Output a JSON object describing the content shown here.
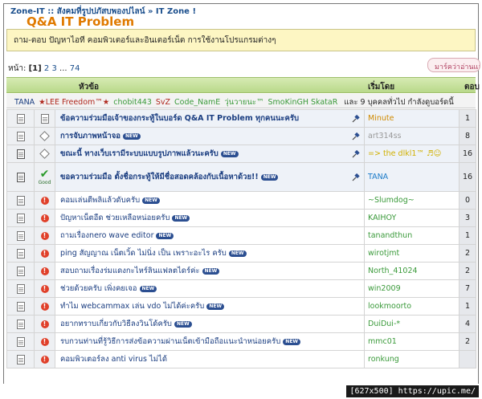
{
  "breadcrumb": {
    "root": "Zone-IT",
    "sep1": "::",
    "community": "สังคมที่รูปปภัสบพองปไลน์",
    "sep2": "»",
    "section": "IT Zone !"
  },
  "forum": {
    "title": "Q&A IT Problem",
    "description": "ถาม-ตอบ ปัญหาไอที คอมพิวเตอร์และอินเตอร์เน็ต การใช้งานโปรแกรมต่างๆ"
  },
  "pager": {
    "label": "หน้า:",
    "current": "[1]",
    "pages": [
      "2",
      "3"
    ],
    "ellipsis": "...",
    "last": "74"
  },
  "mark_read_label": "มาร์คว่าอ่านแล้ว",
  "table_header": {
    "subject": "หัวข้อ",
    "started_by": "เริ่มโดย",
    "replies": "ตอบ"
  },
  "viewers": {
    "users": [
      {
        "name": "TANA",
        "color": "#1a3d80"
      },
      {
        "name": "★LEE Freedom™★",
        "color": "#b0281e"
      },
      {
        "name": "chobit443",
        "color": "#3a9a3a"
      },
      {
        "name": "SvZ",
        "color": "#b0281e"
      },
      {
        "name": "Code_NamE",
        "color": "#3a9a3a"
      },
      {
        "name": "วุ่นวายนะ™",
        "color": "#3a9a3a"
      },
      {
        "name": "SmoKinGH SkataR",
        "color": "#3a9a3a"
      }
    ],
    "suffix": "และ 9 บุคคลทั่วไป กำลังดูบอร์ดนี้"
  },
  "new_badge": "NEW",
  "good_label": "Good",
  "topics": [
    {
      "title": "ข้อความร่วมมือเจ้าของกระทู้ในบอร์ด Q&A IT Problem ทุกคนนะครับ",
      "starter": "Minute",
      "starter_color": "#d08a00",
      "replies": "1",
      "sticky": true,
      "pinned": true,
      "new": false,
      "icon": "doc",
      "status": "note"
    },
    {
      "title": "การจับภาพหน้าจอ",
      "starter": "art314ss",
      "starter_color": "#999999",
      "replies": "8",
      "sticky": true,
      "pinned": true,
      "new": true,
      "icon": "doc",
      "status": "diamond"
    },
    {
      "title": "ขณะนี้ ทางเว็บเรามีระบบแบบรูปภาพแล้วนะครับ",
      "starter": "=> the dlkl1™ ♬☺",
      "starter_color": "#d0b000",
      "replies": "16",
      "sticky": true,
      "pinned": true,
      "new": true,
      "icon": "hot",
      "status": "diamond"
    },
    {
      "title": "ขอความร่วมมือ ตั้งชื่อกระทู้ให้มีชื่อสอดคล้องกับเนื้อหาด้วย!!",
      "starter": "TANA",
      "starter_color": "#1a7ac8",
      "replies": "16",
      "sticky": true,
      "pinned": true,
      "new": true,
      "icon": "hot",
      "status": "good",
      "tall": true
    },
    {
      "title": "คอมเล่นตีพลิแล้วดับครับ",
      "starter": "~Slumdog~",
      "starter_color": "#3a9a3a",
      "replies": "0",
      "sticky": false,
      "pinned": false,
      "new": true,
      "icon": "doc",
      "status": "bang"
    },
    {
      "title": "ปัญหาเน็ตอืด ช่วยเหลือหน่อยครับ",
      "starter": "KAIHOY",
      "starter_color": "#3a9a3a",
      "replies": "3",
      "sticky": false,
      "pinned": false,
      "new": true,
      "icon": "doc",
      "status": "bang"
    },
    {
      "title": "ถามเรื่องnero wave editor",
      "starter": "tanandthun",
      "starter_color": "#3a9a3a",
      "replies": "1",
      "sticky": false,
      "pinned": false,
      "new": true,
      "icon": "doc",
      "status": "bang"
    },
    {
      "title": "ping สัญญาณ เน็ตเวิ้ด ไม่นิ่ง เป็น เพราะอะไร ครับ",
      "starter": "wirotjmt",
      "starter_color": "#3a9a3a",
      "replies": "2",
      "sticky": false,
      "pinned": false,
      "new": true,
      "icon": "doc",
      "status": "bang"
    },
    {
      "title": "สอบถามเรื่องร่มแดงกะไหร์ลินแฟลตไดร์ค่ะ",
      "starter": "North_41024",
      "starter_color": "#3a9a3a",
      "replies": "2",
      "sticky": false,
      "pinned": false,
      "new": true,
      "icon": "doc",
      "status": "bang"
    },
    {
      "title": "ช่วยด้วยครับ เพิ่งคยเจอ",
      "starter": "win2009",
      "starter_color": "#3a9a3a",
      "replies": "7",
      "sticky": false,
      "pinned": false,
      "new": true,
      "icon": "doc",
      "status": "bang"
    },
    {
      "title": "ทำไม webcammax เล่น vdo ไม่ได้ค่ะครับ",
      "starter": "lookmoorto",
      "starter_color": "#3a9a3a",
      "replies": "1",
      "sticky": false,
      "pinned": false,
      "new": true,
      "icon": "doc",
      "status": "bang"
    },
    {
      "title": "อยากทราบเกี่ยวกับวิธีลงวินโด้ครับ",
      "starter": "DuiDui-*",
      "starter_color": "#3a9a3a",
      "replies": "4",
      "sticky": false,
      "pinned": false,
      "new": true,
      "icon": "doc",
      "status": "bang"
    },
    {
      "title": "รบกวนท่านที่รู้วิธีการส่งข้อความผ่านเน็ตเข้ามือถือแนะนำหน่อยครับ",
      "starter": "mmc01",
      "starter_color": "#3a9a3a",
      "replies": "2",
      "sticky": false,
      "pinned": false,
      "new": true,
      "icon": "doc",
      "status": "bang"
    },
    {
      "title": "คอมพิวเตอร์ลง anti virus ไม่ได้",
      "starter": "ronkung",
      "starter_color": "#3a9a3a",
      "replies": "",
      "sticky": false,
      "pinned": false,
      "new": false,
      "icon": "doc",
      "status": "bang"
    }
  ],
  "watermark": "[627x500] https://upic.me/"
}
